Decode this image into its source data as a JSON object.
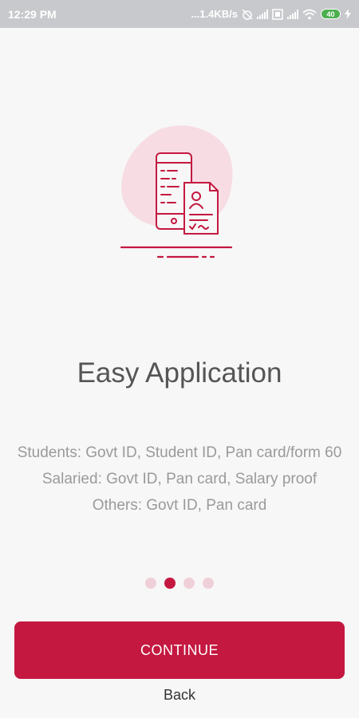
{
  "status_bar": {
    "time": "12:29 PM",
    "network_speed": "...1.4KB/s",
    "battery": "40",
    "icons": [
      "alarm-off-icon",
      "signal-icon",
      "volte-icon",
      "signal-icon",
      "wifi-icon",
      "battery-icon",
      "charging-icon"
    ]
  },
  "illustration": {
    "name": "phone-with-id-document-icon",
    "accent_color": "#c41840",
    "blob_color": "#f7dde3"
  },
  "onboarding": {
    "title": "Easy Application",
    "lines": [
      "Students: Govt ID, Student ID, Pan card/form 60",
      "Salaried: Govt ID, Pan card, Salary proof",
      "Others: Govt ID, Pan card"
    ],
    "page_indicator": {
      "total": 4,
      "active": 2
    }
  },
  "actions": {
    "continue_label": "CONTINUE",
    "back_label": "Back"
  },
  "colors": {
    "primary": "#c41840",
    "dot_inactive": "#f0d0d8",
    "status_bar": "#c8c9cc"
  }
}
